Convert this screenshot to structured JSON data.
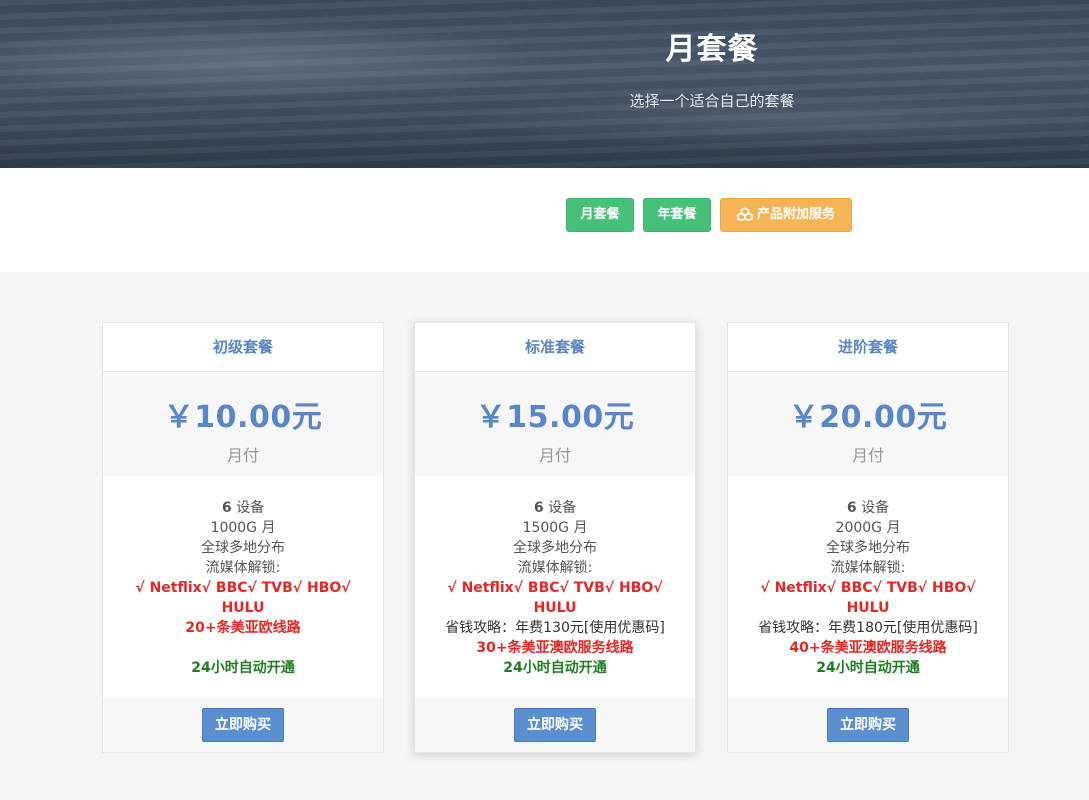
{
  "hero": {
    "title": "月套餐",
    "subtitle": "选择一个适合自己的套餐"
  },
  "tabs": [
    {
      "label": "月套餐"
    },
    {
      "label": "年套餐"
    },
    {
      "label": "产品附加服务",
      "icon": "cubes-icon"
    }
  ],
  "colors": {
    "accent": "#5b86c5",
    "green": "#47c17a",
    "orange": "#f5b556",
    "red": "#e52626"
  },
  "plans": [
    {
      "name": "初级套餐",
      "price": "￥10.00元",
      "period": "月付",
      "devices_num": "6",
      "devices_unit": " 设备",
      "traffic": "1000G 月",
      "distribution": "全球多地分布",
      "unlock_label": "流媒体解锁:",
      "unlock_line1": "√ Netflix√ BBC√ TVB√ HBO√",
      "unlock_line2": "HULU",
      "routes": "20+条美亚欧线路",
      "activation": "24小时自动开通",
      "buy": "立即购买"
    },
    {
      "name": "标准套餐",
      "price": "￥15.00元",
      "period": "月付",
      "devices_num": "6",
      "devices_unit": " 设备",
      "traffic": "1500G 月",
      "distribution": "全球多地分布",
      "unlock_label": "流媒体解锁:",
      "unlock_line1": "√ Netflix√ BBC√ TVB√ HBO√",
      "unlock_line2": "HULU",
      "saving": "省钱攻略：年费130元[使用优惠码]",
      "routes": "30+条美亚澳欧服务线路",
      "activation": "24小时自动开通",
      "buy": "立即购买"
    },
    {
      "name": "进阶套餐",
      "price": "￥20.00元",
      "period": "月付",
      "devices_num": "6",
      "devices_unit": " 设备",
      "traffic": "2000G 月",
      "distribution": "全球多地分布",
      "unlock_label": "流媒体解锁:",
      "unlock_line1": "√ Netflix√ BBC√ TVB√ HBO√",
      "unlock_line2": "HULU",
      "saving": "省钱攻略：年费180元[使用优惠码]",
      "routes": "40+条美亚澳欧服务线路",
      "activation": "24小时自动开通",
      "buy": "立即购买"
    }
  ]
}
